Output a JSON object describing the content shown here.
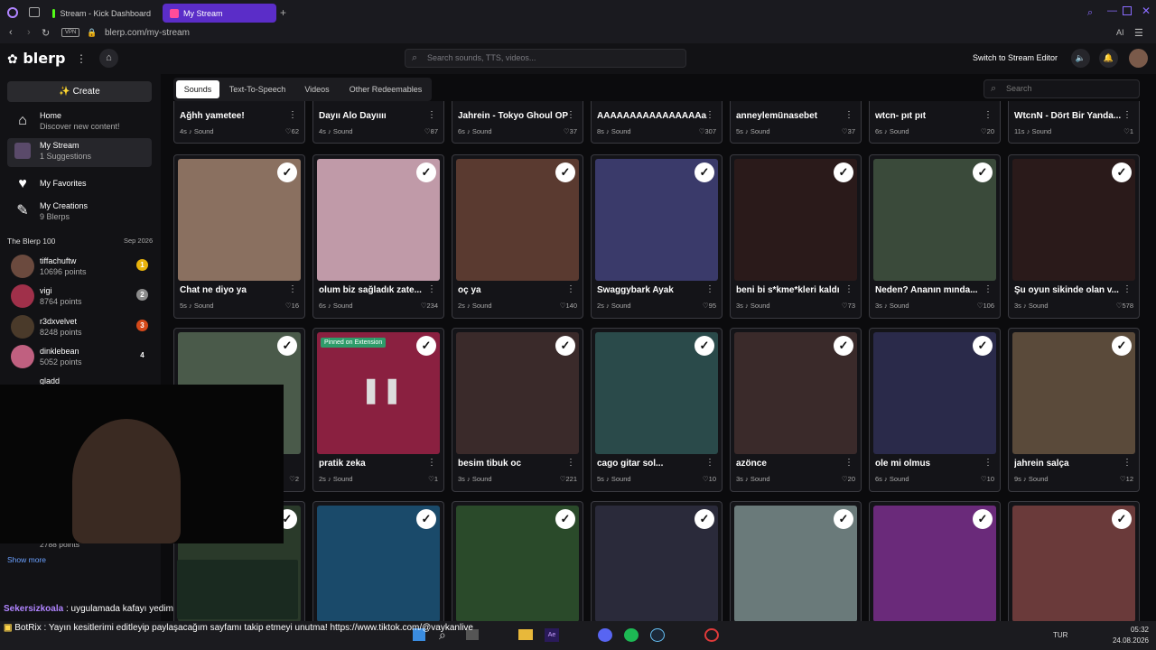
{
  "browser": {
    "tabs": [
      {
        "label": "Stream - Kick Dashboard"
      },
      {
        "label": "My Stream"
      }
    ],
    "vpn": "VPN",
    "url": "blerp.com/my-stream"
  },
  "header": {
    "logo": "blerp",
    "search_placeholder": "Search sounds, TTS, videos...",
    "switch_editor": "Switch to Stream Editor"
  },
  "sidebar": {
    "create": "Create",
    "nav": [
      {
        "title": "Home",
        "sub": "Discover new content!"
      },
      {
        "title": "My Stream",
        "sub": "1 Suggestions"
      },
      {
        "title": "My Favorites",
        "sub": ""
      },
      {
        "title": "My Creations",
        "sub": "9 Blerps"
      }
    ],
    "ranking_title": "The Blerp 100",
    "ranking_date": "Sep 2026",
    "ranking": [
      {
        "name": "tiffachuftw",
        "points": "10696 points",
        "rank": "1",
        "color": "#e8b30c"
      },
      {
        "name": "vigi",
        "points": "8764 points",
        "rank": "2",
        "color": "#8c8c8c"
      },
      {
        "name": "r3dxvelvet",
        "points": "8248 points",
        "rank": "3",
        "color": "#d4491a"
      },
      {
        "name": "dinklebean",
        "points": "5052 points",
        "rank": "4",
        "color": "#121215"
      },
      {
        "name": "gladd",
        "points": "",
        "rank": "",
        "color": "#121215"
      }
    ],
    "last_points": "2788 points",
    "show_more": "Show more"
  },
  "tabs": [
    {
      "label": "Sounds"
    },
    {
      "label": "Text-To-Speech"
    },
    {
      "label": "Videos"
    },
    {
      "label": "Other Redeemables"
    }
  ],
  "search_right": "Search",
  "row0": [
    {
      "title": "Ağhh yametee!",
      "dur": "4s",
      "type": "Sound",
      "likes": "62"
    },
    {
      "title": "Dayıı Alo Dayıııı",
      "dur": "4s",
      "type": "Sound",
      "likes": "87"
    },
    {
      "title": "Jahrein - Tokyo Ghoul OP",
      "dur": "6s",
      "type": "Sound",
      "likes": "37"
    },
    {
      "title": "AAAAAAAAAAAAAAAAa...",
      "dur": "8s",
      "type": "Sound",
      "likes": "307"
    },
    {
      "title": "anneylemünasebet",
      "dur": "5s",
      "type": "Sound",
      "likes": "37"
    },
    {
      "title": "wtcn- pıt pıt",
      "dur": "6s",
      "type": "Sound",
      "likes": "20"
    },
    {
      "title": "WtcnN - Dört Bir Yanda...",
      "dur": "11s",
      "type": "Sound",
      "likes": "1"
    }
  ],
  "row1": [
    {
      "title": "Chat ne diyo ya",
      "dur": "5s",
      "type": "Sound",
      "likes": "16",
      "color": "#8a7060"
    },
    {
      "title": "olum biz sağladık zate...",
      "dur": "6s",
      "type": "Sound",
      "likes": "234",
      "color": "#c09aa8"
    },
    {
      "title": "oç ya",
      "dur": "2s",
      "type": "Sound",
      "likes": "140",
      "color": "#5a3a30"
    },
    {
      "title": "Swaggybark Ayak",
      "dur": "2s",
      "type": "Sound",
      "likes": "95",
      "color": "#3a3a6a"
    },
    {
      "title": "beni bi s*kme*kleri kaldı",
      "dur": "3s",
      "type": "Sound",
      "likes": "73",
      "color": "#2a1a1a"
    },
    {
      "title": "Neden? Ananın mında...",
      "dur": "3s",
      "type": "Sound",
      "likes": "106",
      "color": "#3a4a3a"
    },
    {
      "title": "Şu oyun sikinde olan v...",
      "dur": "3s",
      "type": "Sound",
      "likes": "578",
      "color": "#2a1a1a"
    }
  ],
  "row2": [
    {
      "title": "",
      "dur": "",
      "type": "",
      "likes": "2",
      "color": "#4a5a4a"
    },
    {
      "title": "pratik zeka",
      "dur": "2s",
      "type": "Sound",
      "likes": "1",
      "color": "#8a2040",
      "pinned": "Pinned on Extension"
    },
    {
      "title": "besim tibuk oc",
      "dur": "3s",
      "type": "Sound",
      "likes": "221",
      "color": "#3a2a2a"
    },
    {
      "title": "cago gitar sol...",
      "dur": "5s",
      "type": "Sound",
      "likes": "10",
      "color": "#2a4a4a"
    },
    {
      "title": "azönce",
      "dur": "3s",
      "type": "Sound",
      "likes": "20",
      "color": "#3a2a2a"
    },
    {
      "title": "ole mi olmus",
      "dur": "6s",
      "type": "Sound",
      "likes": "10",
      "color": "#2a2a4a"
    },
    {
      "title": "jahrein salça",
      "dur": "9s",
      "type": "Sound",
      "likes": "12",
      "color": "#5a4a3a"
    }
  ],
  "row3_colors": [
    "#2a3a2a",
    "#1a4a6a",
    "#2a4a2a",
    "#2a2a3a",
    "#6a7a7a",
    "#6a2a7a",
    "#6a3a3a"
  ],
  "chat": {
    "line1_user": "Sekersizkoala",
    "line1_text": " : uygulamada kafayı yedim",
    "line2": "BotRix : Yayın kesitlerimi editleyip paylaşacağım sayfamı takip etmeyi unutma! https://www.tiktok.com/@vaykanlive"
  },
  "taskbar": {
    "lang": "TUR",
    "time": "05:32",
    "date": "24.08.2026"
  }
}
